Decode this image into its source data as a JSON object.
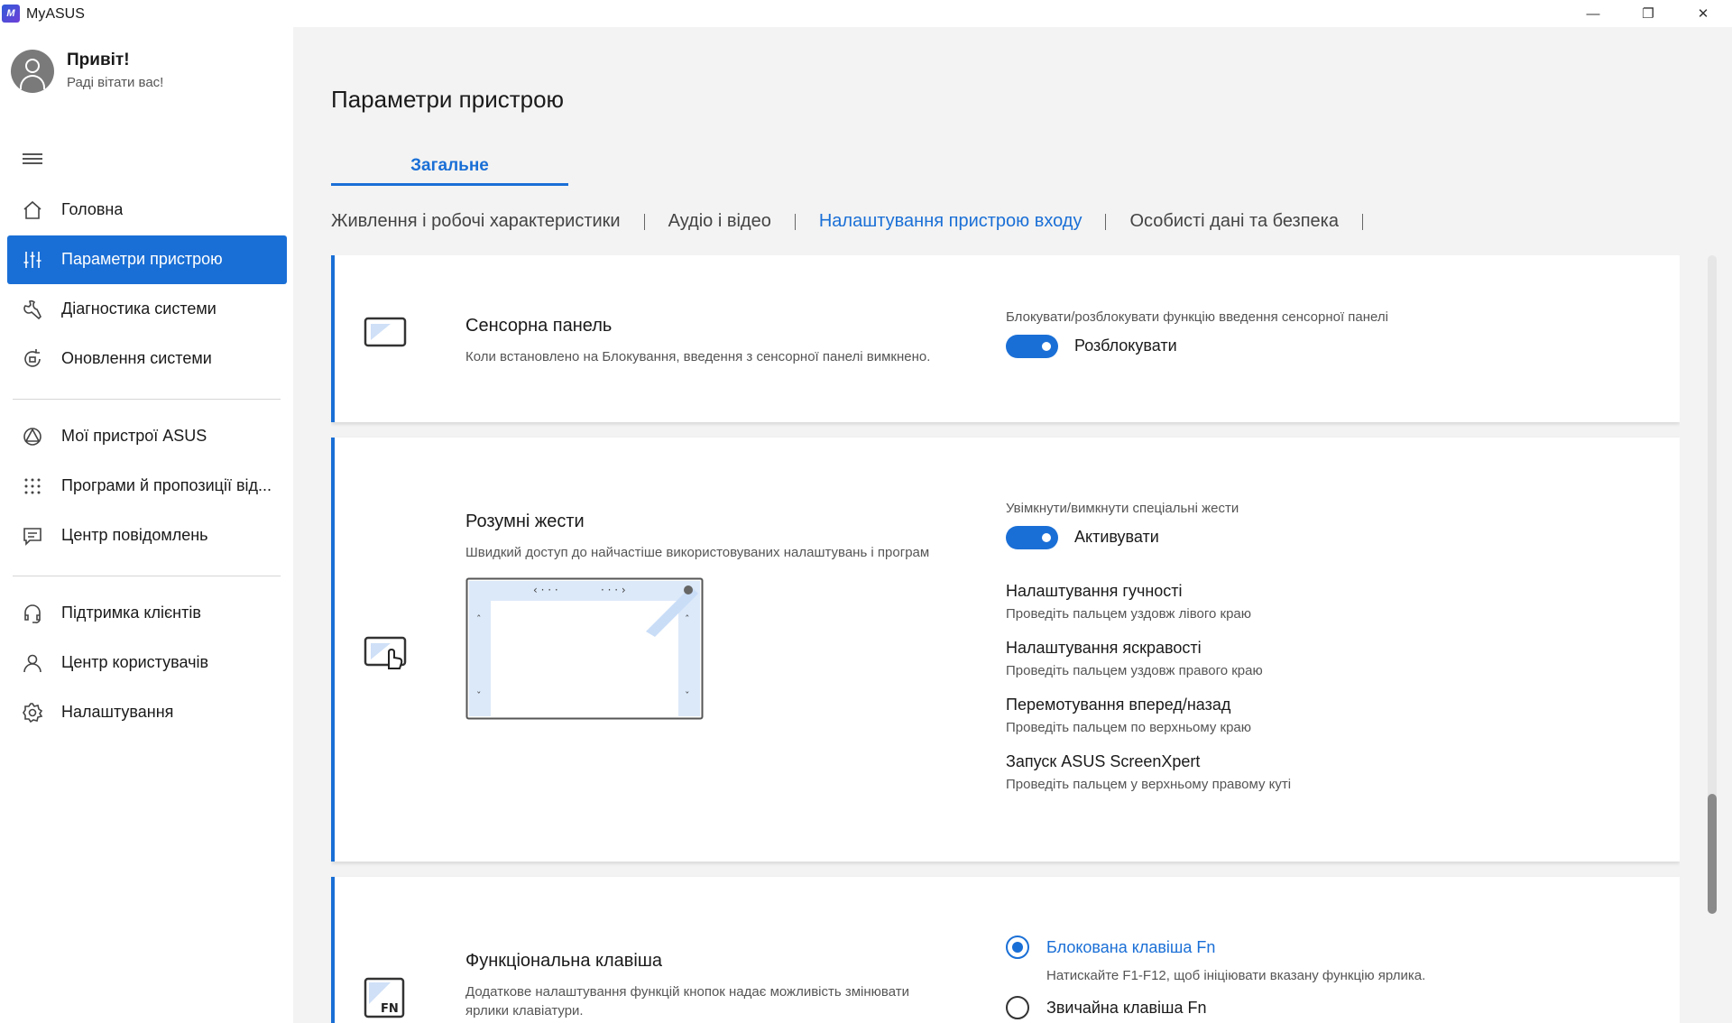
{
  "window": {
    "title": "MyASUS",
    "logo_text": "M",
    "minimize_glyph": "—",
    "maximize_glyph": "❐",
    "close_glyph": "✕"
  },
  "sidebar": {
    "greeting": "Привіт!",
    "greeting_sub": "Раді вітати вас!",
    "items": [
      {
        "label": "Головна",
        "icon": "home-icon"
      },
      {
        "label": "Параметри пристрою",
        "icon": "sliders-icon",
        "active": true
      },
      {
        "label": "Діагностика системи",
        "icon": "wrench-icon"
      },
      {
        "label": "Оновлення системи",
        "icon": "update-icon"
      },
      {
        "label": "Мої пристрої ASUS",
        "icon": "devices-icon"
      },
      {
        "label": "Програми й пропозиції від...",
        "icon": "apps-grid-icon"
      },
      {
        "label": "Центр повідомлень",
        "icon": "message-icon"
      },
      {
        "label": "Підтримка клієнтів",
        "icon": "headset-icon"
      },
      {
        "label": "Центр користувачів",
        "icon": "user-icon"
      },
      {
        "label": "Налаштування",
        "icon": "gear-icon"
      }
    ]
  },
  "main": {
    "page_title": "Параметри пристрою",
    "tab": "Загальне",
    "subtabs": [
      "Живлення і робочі характеристики",
      "Аудіо і відео",
      "Налаштування пристрою входу",
      "Особисті дані та безпека"
    ],
    "active_subtab": 2
  },
  "cards": {
    "touchpad": {
      "title": "Сенсорна панель",
      "desc": "Коли встановлено на Блокування, введення з сенсорної панелі вимкнено.",
      "option_label": "Блокувати/розблокувати функцію введення сенсорної панелі",
      "toggle_label": "Розблокувати",
      "toggle_on": true
    },
    "gestures": {
      "title": "Розумні жести",
      "desc": "Швидкий доступ до найчастіше використовуваних налаштувань і програм",
      "option_label": "Увімкнути/вимкнути спеціальні жести",
      "toggle_label": "Активувати",
      "toggle_on": true,
      "items": [
        {
          "title": "Налаштування гучності",
          "desc": "Проведіть пальцем уздовж лівого краю"
        },
        {
          "title": "Налаштування яскравості",
          "desc": "Проведіть пальцем уздовж правого краю"
        },
        {
          "title": "Перемотування вперед/назад",
          "desc": "Проведіть пальцем по верхньому краю"
        },
        {
          "title": "Запуск ASUS ScreenXpert",
          "desc": "Проведіть пальцем у верхньому правому куті"
        }
      ]
    },
    "fnkey": {
      "title": "Функціональна клавіша",
      "desc_line1": "Додаткове налаштування функцій кнопок надає можливість змінювати",
      "desc_line2": "ярлики клавіатури.",
      "icon_text": "FN",
      "options": [
        {
          "label": "Блокована клавіша Fn",
          "desc": "Натискайте F1-F12, щоб ініціювати вказану функцію ярлика.",
          "checked": true
        },
        {
          "label": "Звичайна клавіша Fn",
          "checked": false
        }
      ]
    }
  },
  "colors": {
    "accent": "#1a6fd6",
    "background": "#f3f3f3"
  }
}
